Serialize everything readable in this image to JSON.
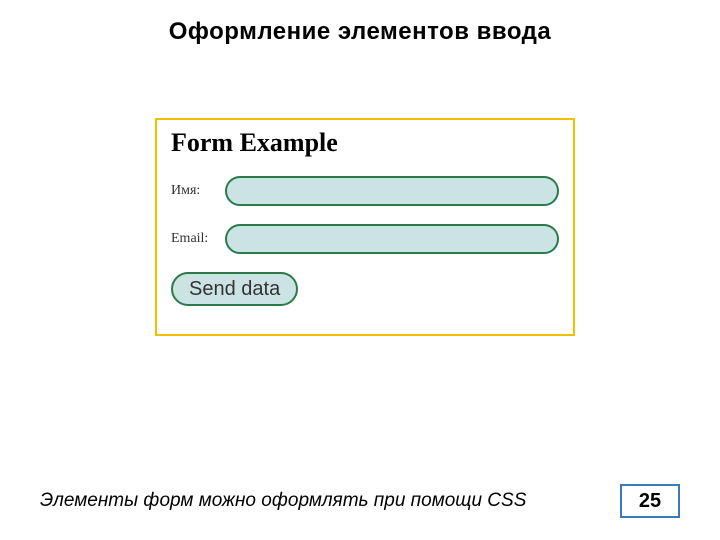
{
  "slide": {
    "title": "Оформление элементов ввода",
    "footer_note": "Элементы форм можно оформлять при помощи CSS",
    "page_number": "25"
  },
  "form": {
    "heading": "Form Example",
    "name_label": "Имя:",
    "email_label": "Email:",
    "submit_label": "Send data"
  }
}
